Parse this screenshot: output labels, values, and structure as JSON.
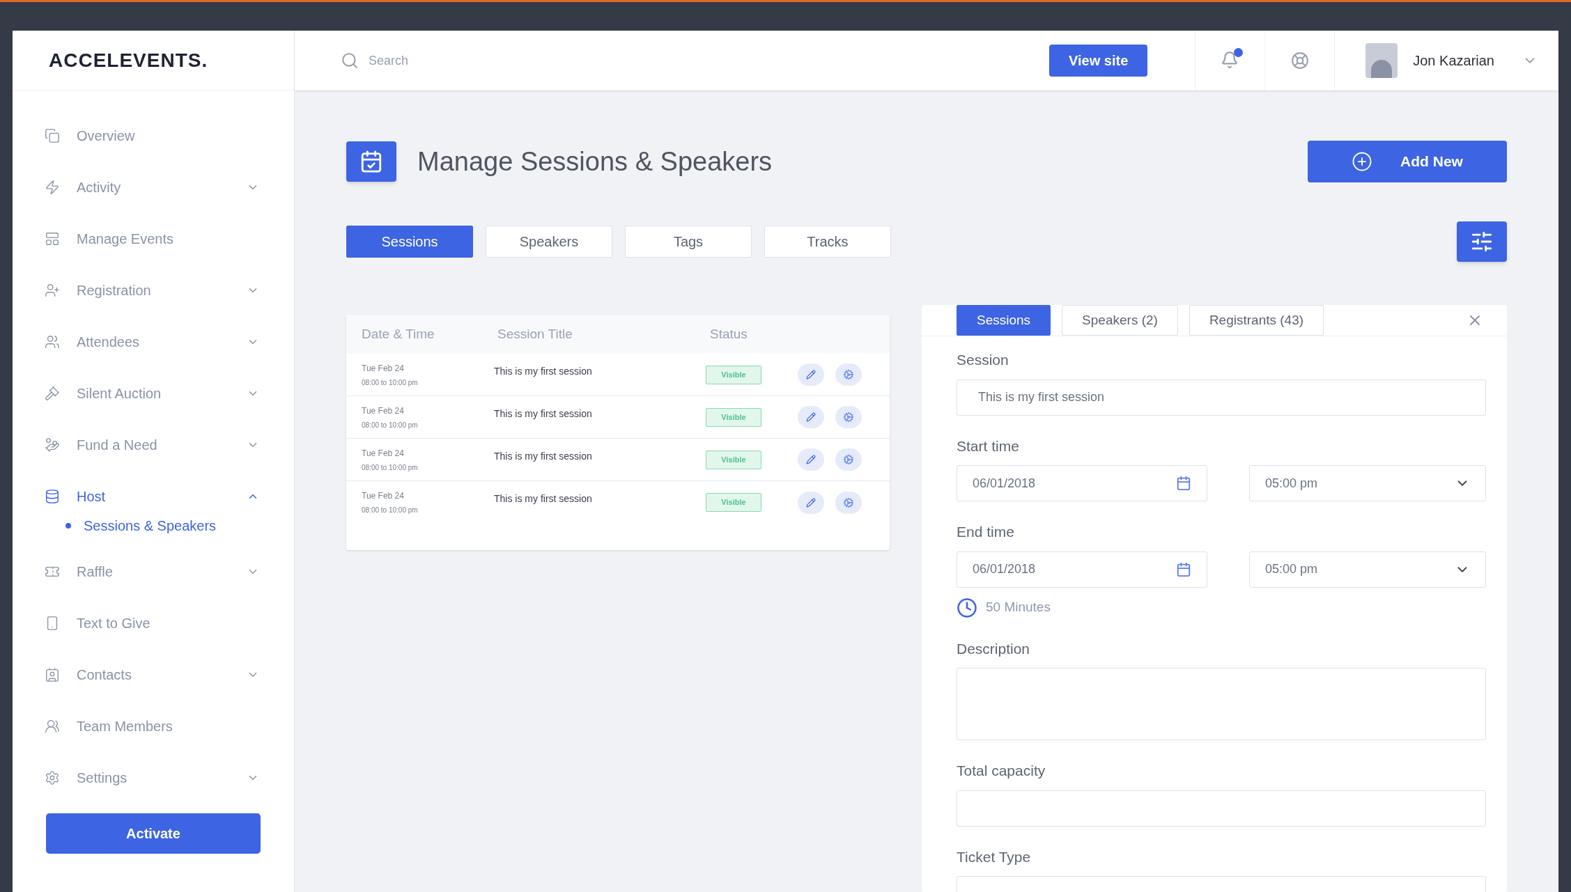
{
  "brand": {
    "name": "ACCELEVENTS."
  },
  "header": {
    "search": {
      "placeholder": "Search"
    },
    "view_site": "View site",
    "user": {
      "name": "Jon Kazarian"
    }
  },
  "sidebar": {
    "items": [
      {
        "label": "Overview",
        "selected": false
      },
      {
        "label": "Activity",
        "selected": false,
        "expanded": false
      },
      {
        "label": "Manage Events",
        "selected": false
      },
      {
        "label": "Registration",
        "selected": false,
        "expanded": false
      },
      {
        "label": "Attendees",
        "selected": false,
        "expanded": false
      },
      {
        "label": "Silent Auction",
        "selected": false,
        "expanded": false
      },
      {
        "label": "Fund a Need",
        "selected": false,
        "expanded": false
      },
      {
        "label": "Host",
        "selected": true,
        "expanded": true,
        "children": [
          {
            "label": "Sessions & Speakers",
            "selected": true
          }
        ]
      },
      {
        "label": "Raffle",
        "selected": false,
        "expanded": false
      },
      {
        "label": "Text to Give",
        "selected": false
      },
      {
        "label": "Contacts",
        "selected": false,
        "expanded": false
      },
      {
        "label": "Team Members",
        "selected": false
      },
      {
        "label": "Settings",
        "selected": false,
        "expanded": false
      }
    ],
    "activate": "Activate"
  },
  "page": {
    "title": "Manage Sessions & Speakers",
    "add_new": "Add New",
    "tabs": [
      {
        "label": "Sessions",
        "selected": true
      },
      {
        "label": "Speakers",
        "selected": false
      },
      {
        "label": "Tags",
        "selected": false
      },
      {
        "label": "Tracks",
        "selected": false
      }
    ]
  },
  "table": {
    "columns": [
      "Date & Time",
      "Session Title",
      "Status"
    ],
    "rows": [
      {
        "date": "Tue Feb 24",
        "time": "08:00 to 10:00 pm",
        "title": "This is my first session",
        "status": "Visible"
      },
      {
        "date": "Tue Feb 24",
        "time": "08:00 to 10:00 pm",
        "title": "This is my first session",
        "status": "Visible"
      },
      {
        "date": "Tue Feb 24",
        "time": "08:00 to 10:00 pm",
        "title": "This is my first session",
        "status": "Visible"
      },
      {
        "date": "Tue Feb 24",
        "time": "08:00 to 10:00 pm",
        "title": "This is my first session",
        "status": "Visible"
      }
    ]
  },
  "panel": {
    "tabs": [
      {
        "label": "Sessions",
        "selected": true
      },
      {
        "label": "Speakers (2)",
        "selected": false
      },
      {
        "label": "Registrants (43)",
        "selected": false
      }
    ],
    "fields": [
      {
        "kind": "text",
        "label": "Session",
        "value": "This is my first session"
      },
      {
        "kind": "datetime",
        "label": "Start time",
        "date": "06/01/2018",
        "time": "05:00 pm"
      },
      {
        "kind": "datetime",
        "label": "End time",
        "date": "06/01/2018",
        "time": "05:00 pm",
        "duration": "50 Minutes"
      },
      {
        "kind": "textarea",
        "label": "Description"
      },
      {
        "kind": "text",
        "label": "Total capacity"
      },
      {
        "kind": "text",
        "label": "Ticket Type"
      }
    ]
  }
}
